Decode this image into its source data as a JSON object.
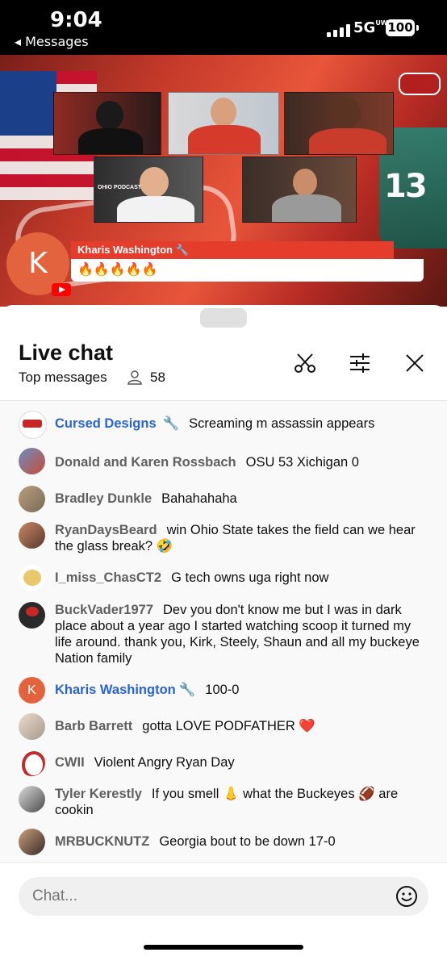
{
  "status": {
    "time": "9:04",
    "back_label": "◂ Messages",
    "network": "5G",
    "network_sub": "UW",
    "battery": "100"
  },
  "video": {
    "overlay_author": "Kharis Washington 🔧",
    "overlay_message": "🔥🔥🔥🔥🔥",
    "overlay_avatar": "K",
    "jersey_number": "13",
    "podcast_label": "OHIO PODCAST"
  },
  "chat": {
    "title": "Live chat",
    "filter_label": "Top messages",
    "viewer_count": "58",
    "input_placeholder": "Chat...",
    "messages": [
      {
        "author": "Cursed Designs",
        "badge": "🔧",
        "text": "Screaming m assassin appears",
        "owner": true
      },
      {
        "author": "Donald and Karen Rossbach",
        "text": "OSU 53 Xichigan 0"
      },
      {
        "author": "Bradley Dunkle",
        "text": "Bahahahaha"
      },
      {
        "author": "RyanDaysBeard",
        "text": "win Ohio State takes the field can we hear the glass break? 🤣"
      },
      {
        "author": "I_miss_ChasCT2",
        "text": "G tech owns uga right now"
      },
      {
        "author": "BuckVader1977",
        "text": "Dev you don't know me but I was in dark place about a year ago I started watching scoop it turned my life around. thank you, Kirk, Steely, Shaun and all my buckeye Nation family"
      },
      {
        "author": "Kharis Washington",
        "badge": "🔧",
        "text": "100-0",
        "owner": true,
        "avatar_letter": "K"
      },
      {
        "author": "Barb Barrett",
        "text": "gotta LOVE PODFATHER ❤️"
      },
      {
        "author": "CWII",
        "text": "Violent Angry Ryan Day"
      },
      {
        "author": "Tyler Kerestly",
        "text": "If you smell 👃 what the Buckeyes 🏈 are cookin"
      },
      {
        "author": "MRBUCKNUTZ",
        "text": "Georgia bout to be down 17-0"
      }
    ],
    "floating_emoji": "😄",
    "heart": "❤️"
  },
  "icons": {
    "scissors": "scissors-icon",
    "filter": "sliders-icon",
    "close": "close-icon",
    "emoji": "smiley-icon"
  }
}
